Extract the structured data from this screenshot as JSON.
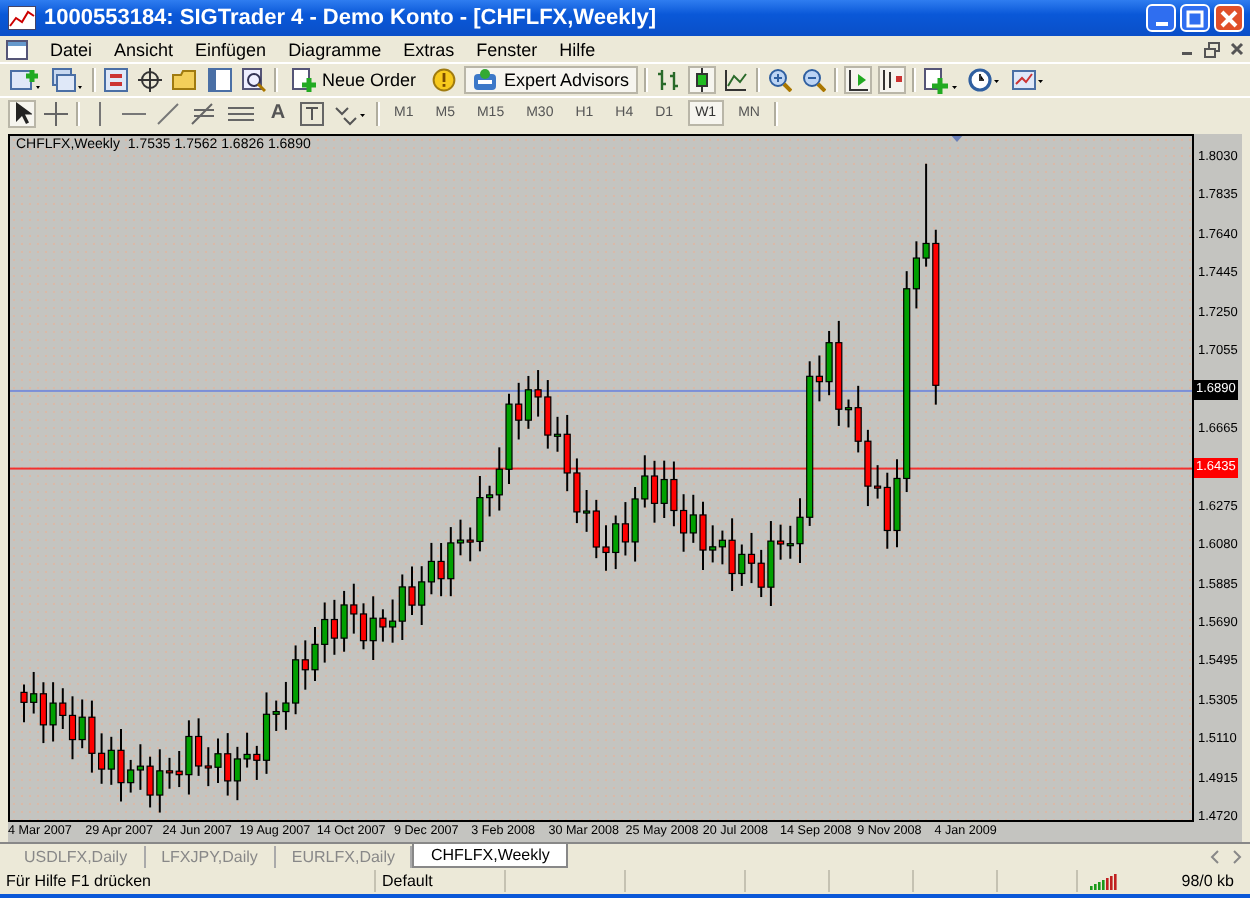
{
  "window": {
    "title": "1000553184: SIGTrader 4 - Demo Konto - [CHFLFX,Weekly]"
  },
  "menu": [
    "Datei",
    "Ansicht",
    "Einfügen",
    "Diagramme",
    "Extras",
    "Fenster",
    "Hilfe"
  ],
  "toolbar": {
    "new_order": "Neue Order",
    "expert_advisors": {
      "label": "Expert Advisors",
      "on": true
    },
    "bar_chart": false,
    "candle_chart": true,
    "line_chart": false,
    "auto_scroll": true,
    "chart_shift": true
  },
  "drawing_toolbar": {
    "cursor": true,
    "crosshair": false,
    "text_tool": "A"
  },
  "periods": [
    {
      "label": "M1",
      "selected": false
    },
    {
      "label": "M5",
      "selected": false
    },
    {
      "label": "M15",
      "selected": false
    },
    {
      "label": "M30",
      "selected": false
    },
    {
      "label": "H1",
      "selected": false
    },
    {
      "label": "H4",
      "selected": false
    },
    {
      "label": "D1",
      "selected": false
    },
    {
      "label": "W1",
      "selected": true
    },
    {
      "label": "MN",
      "selected": false
    }
  ],
  "chart": {
    "symbol": "CHFLFX,Weekly",
    "ohlc": "1.7535 1.7562 1.6826 1.6890",
    "price_axis": [
      {
        "kind": "tick",
        "label": "1.8030"
      },
      {
        "kind": "tick",
        "label": "1.7835"
      },
      {
        "kind": "tick",
        "label": "1.7640"
      },
      {
        "kind": "tick",
        "label": "1.7445"
      },
      {
        "kind": "tick",
        "label": "1.7250"
      },
      {
        "kind": "tick",
        "label": "1.7055"
      },
      {
        "kind": "price",
        "label": "1.6890"
      },
      {
        "kind": "tick",
        "label": "1.6665"
      },
      {
        "kind": "level",
        "label": "1.6435",
        "color": "#ff0000"
      },
      {
        "kind": "tick",
        "label": "1.6275"
      },
      {
        "kind": "tick",
        "label": "1.6080"
      },
      {
        "kind": "tick",
        "label": "1.5885"
      },
      {
        "kind": "tick",
        "label": "1.5690"
      },
      {
        "kind": "tick",
        "label": "1.5495"
      },
      {
        "kind": "tick",
        "label": "1.5305"
      },
      {
        "kind": "tick",
        "label": "1.5110"
      },
      {
        "kind": "tick",
        "label": "1.4915"
      },
      {
        "kind": "tick",
        "label": "1.4720"
      }
    ],
    "time_axis": [
      "4 Mar 2007",
      "29 Apr 2007",
      "24 Jun 2007",
      "19 Aug 2007",
      "14 Oct 2007",
      "9 Dec 2007",
      "3 Feb 2008",
      "30 Mar 2008",
      "25 May 2008",
      "20 Jul 2008",
      "14 Sep 2008",
      "9 Nov 2008",
      "4 Jan 2009"
    ]
  },
  "chart_tabs": [
    {
      "label": "USDLFX,Daily",
      "selected": false
    },
    {
      "label": "LFXJPY,Daily",
      "selected": false
    },
    {
      "label": "EURLFX,Daily",
      "selected": false
    },
    {
      "label": "CHFLFX,Weekly",
      "selected": true
    }
  ],
  "status_bar": {
    "help": "Für Hilfe F1 drücken",
    "profile": "Default",
    "traffic": "98/0 kb"
  }
}
